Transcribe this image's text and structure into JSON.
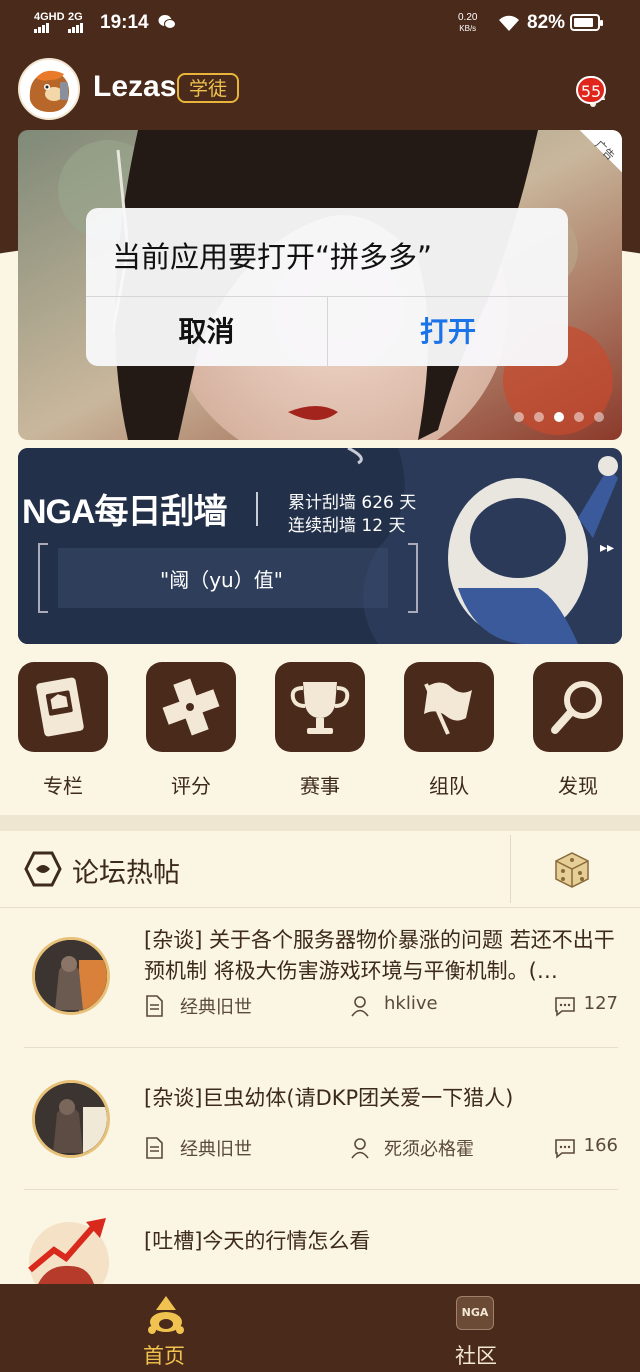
{
  "status_bar": {
    "network1": "4GHD",
    "network2": "2G",
    "time": "19:14",
    "speed": "0.20",
    "speed_unit": "KB/s",
    "battery": "82%"
  },
  "header": {
    "username": "Lezas",
    "rank_badge": "学徒",
    "notification_count": "55"
  },
  "ad_banner": {
    "ad_label": "广告",
    "active_dot": 2,
    "dot_count": 5
  },
  "dialog": {
    "message": "当前应用要打开“拼多多”",
    "cancel_label": "取消",
    "open_label": "打开"
  },
  "signin_card": {
    "logo_text": "NGA每日刮墙",
    "total_days": "累计刮墙 626 天",
    "streak_days": "连续刮墙 12 天",
    "quote": "\"阈（yu）值\""
  },
  "shortcuts": [
    {
      "label": "专栏",
      "icon": "column-book-icon"
    },
    {
      "label": "评分",
      "icon": "gamepad-rating-icon"
    },
    {
      "label": "赛事",
      "icon": "trophy-icon"
    },
    {
      "label": "组队",
      "icon": "flag-team-icon"
    },
    {
      "label": "发现",
      "icon": "magnifier-discover-icon"
    }
  ],
  "forum": {
    "section_title": "论坛热帖",
    "posts": [
      {
        "title": "[杂谈] 关于各个服务器物价暴涨的问题 若还不出干预机制 将极大伤害游戏环境与平衡机制。(…",
        "board": "经典旧世",
        "author": "hklive",
        "replies": "127"
      },
      {
        "title": "[杂谈]巨虫幼体(请DKP团关爱一下猎人)",
        "board": "经典旧世",
        "author": "死须必格霍",
        "replies": "166"
      },
      {
        "title": "[吐槽]今天的行情怎么看",
        "board": "",
        "author": "",
        "replies": ""
      }
    ]
  },
  "tabbar": {
    "home_label": "首页",
    "community_label": "社区",
    "community_icon_text": "NGA",
    "active_color": "#f0c350",
    "inactive_color": "#f2e8d5"
  },
  "colors": {
    "brand_brown": "#4a2a1a",
    "background": "#fbf5e3",
    "accent_gold": "#e8b43b",
    "dialog_blue": "#1a73e8"
  }
}
